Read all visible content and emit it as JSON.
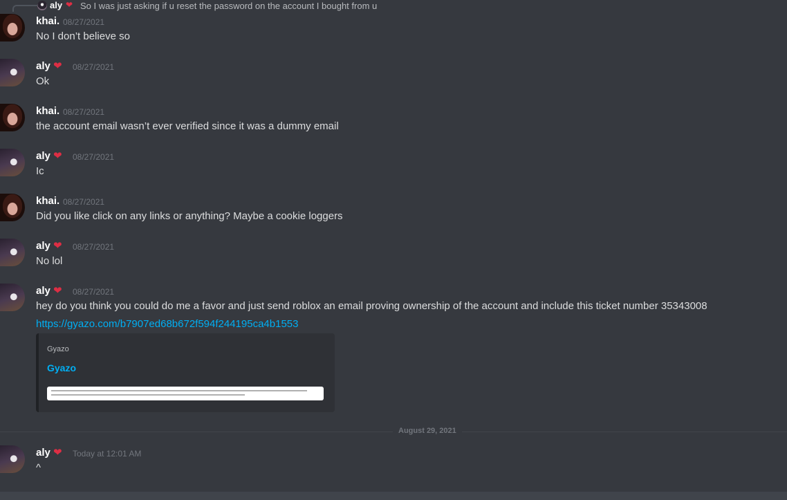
{
  "reply": {
    "author": "aly",
    "text": "So I was just asking if u reset the password on the account I bought from u"
  },
  "messages": [
    {
      "author": "khai.",
      "avatar": "khai-avatar",
      "timestamp": "08/27/2021",
      "text": "No I don’t believe so"
    },
    {
      "author": "aly",
      "avatar": "aly-avatar",
      "badge": "❤",
      "timestamp": "08/27/2021",
      "text": "Ok"
    },
    {
      "author": "khai.",
      "avatar": "khai-avatar",
      "timestamp": "08/27/2021",
      "text": "the account email wasn’t ever verified since it was a dummy email"
    },
    {
      "author": "aly",
      "avatar": "aly-avatar",
      "badge": "❤",
      "timestamp": "08/27/2021",
      "text": "Ic"
    },
    {
      "author": "khai.",
      "avatar": "khai-avatar",
      "timestamp": "08/27/2021",
      "text": "Did you like click on any links or anything? Maybe a cookie loggers"
    },
    {
      "author": "aly",
      "avatar": "aly-avatar",
      "badge": "❤",
      "timestamp": "08/27/2021",
      "text": "No lol"
    },
    {
      "author": "aly",
      "avatar": "aly-avatar",
      "badge": "❤",
      "timestamp": "08/27/2021",
      "text": "hey do you think you could do me a favor and just send roblox an email proving ownership of the account and include this ticket number 35343008",
      "link": "https://gyazo.com/b7907ed68b672f594f244195ca4b1553",
      "embed": {
        "provider": "Gyazo",
        "title": "Gyazo"
      }
    },
    {
      "author": "aly",
      "avatar": "aly-avatar",
      "badge": "❤",
      "timestamp": "Today at 12:01 AM",
      "text": "^"
    }
  ],
  "date_divider": "August 29, 2021",
  "colors": {
    "background": "#36393f",
    "link": "#00aff4",
    "heart": "#dd2e44",
    "timestamp": "#72767d"
  }
}
